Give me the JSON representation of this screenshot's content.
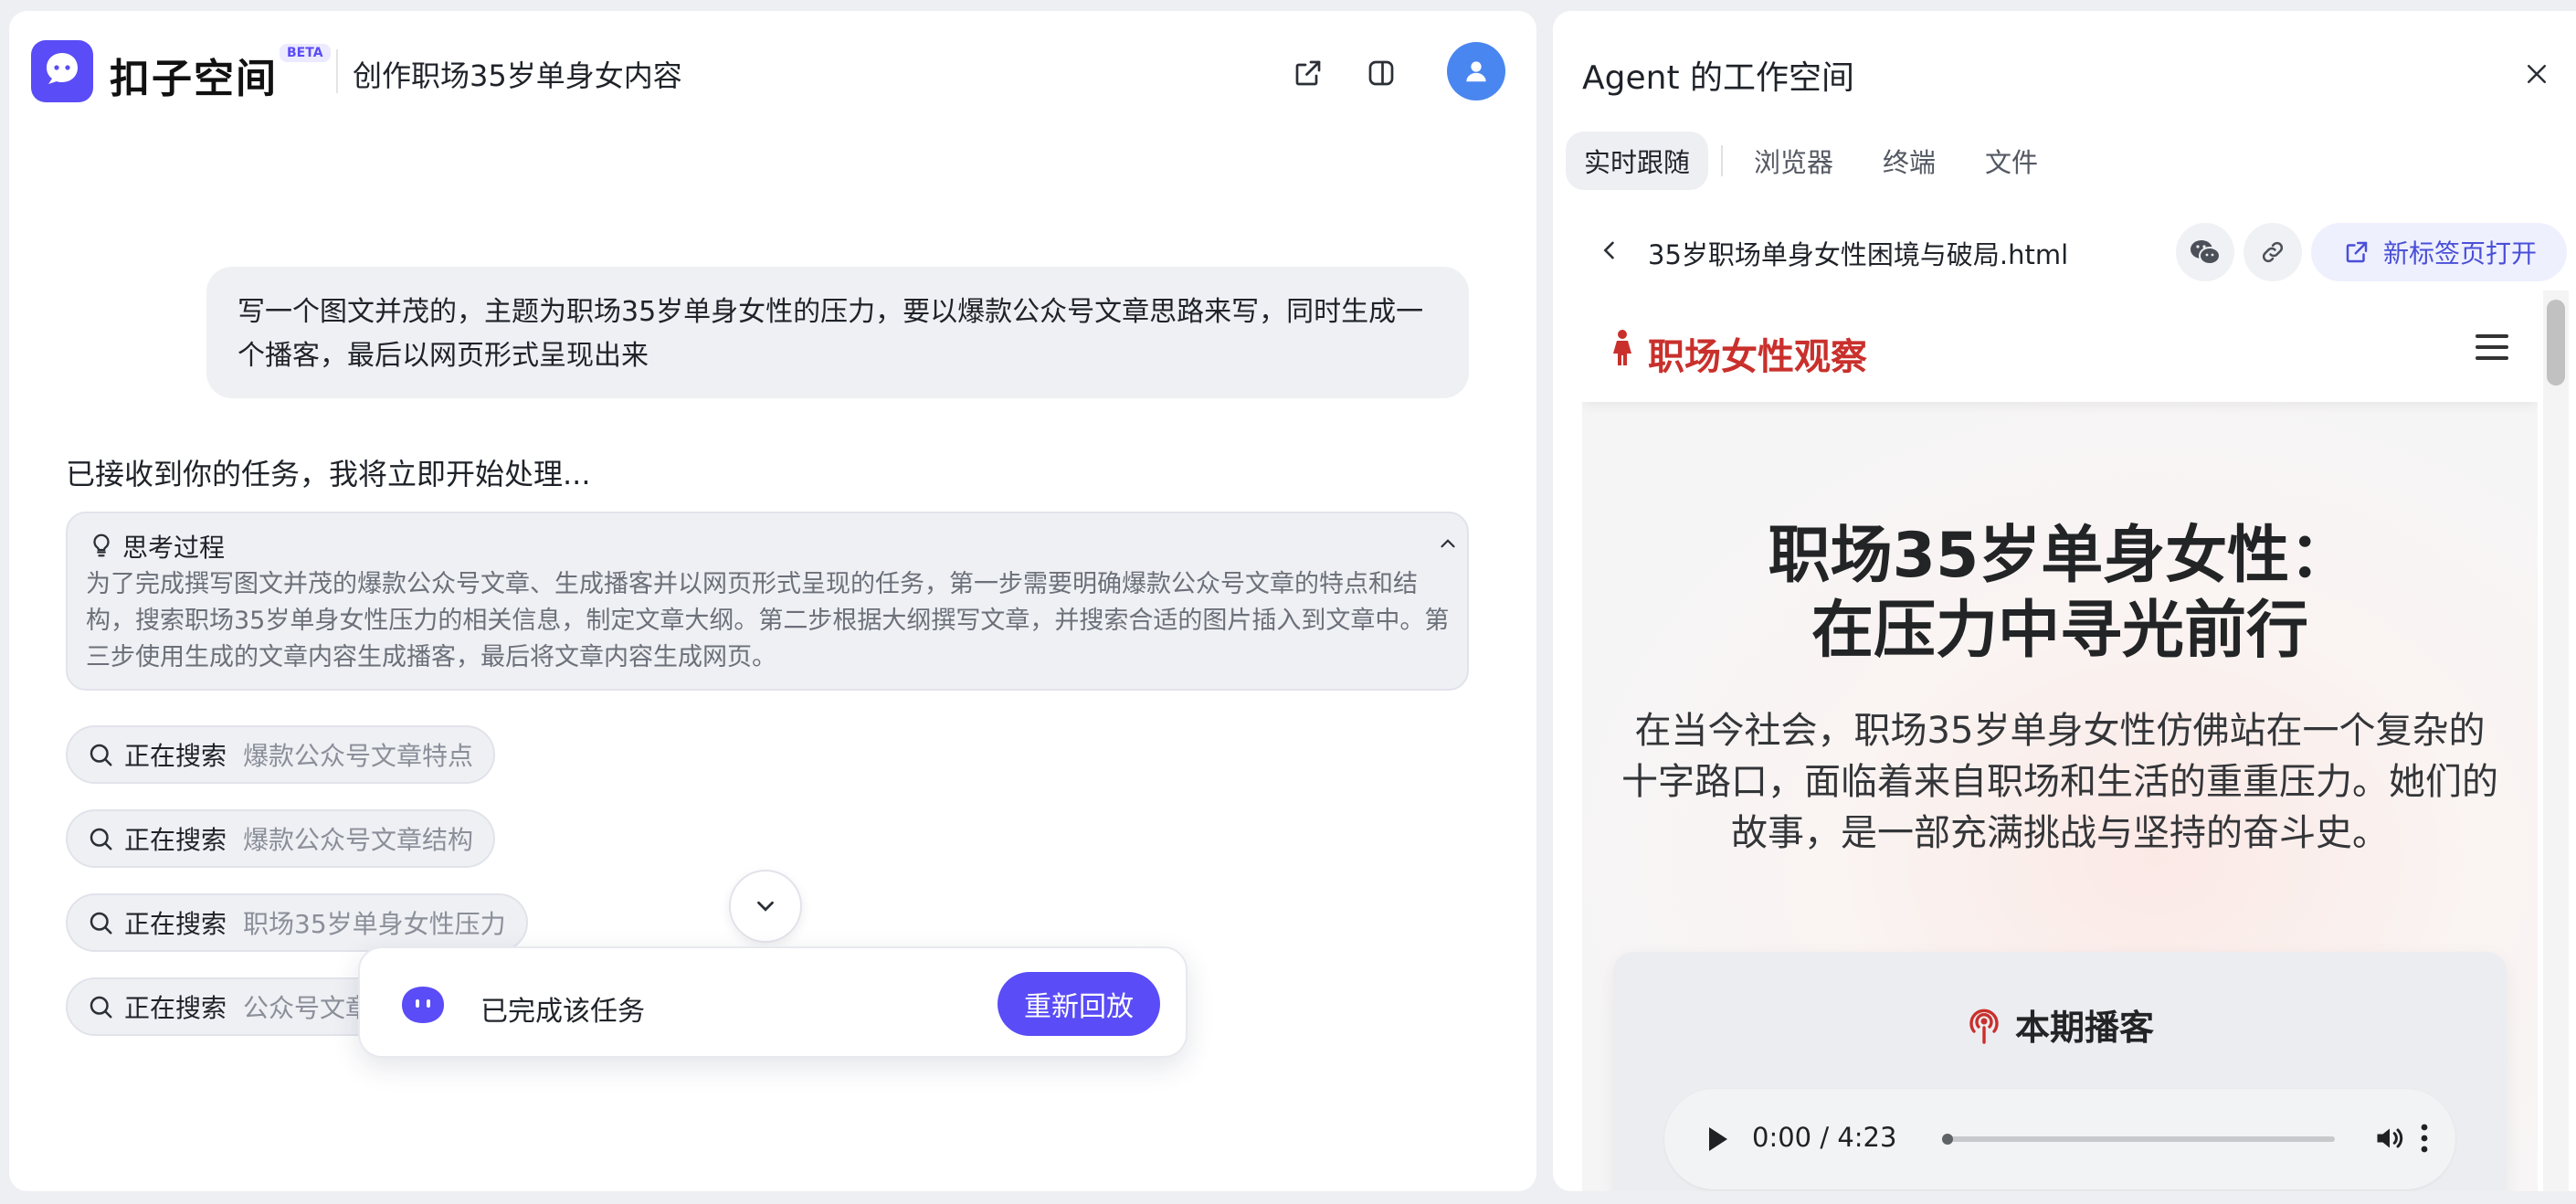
{
  "app": {
    "logo_text": "扣子空间",
    "beta": "BETA",
    "task_title": "创作职场35岁单身女内容",
    "brand_color": "#5a4cf6"
  },
  "header": {
    "share_icon": "share-icon",
    "panel_icon": "split-panel-icon",
    "avatar_icon": "user-icon"
  },
  "chat": {
    "user_message": "写一个图文并茂的，主题为职场35岁单身女性的压力，要以爆款公众号文章思路来写，同时生成一个播客，最后以网页形式呈现出来",
    "ack": "已接收到你的任务，我将立即开始处理...",
    "thinking": {
      "title": "思考过程",
      "body": "为了完成撰写图文并茂的爆款公众号文章、生成播客并以网页形式呈现的任务，第一步需要明确爆款公众号文章的特点和结构，搜索职场35岁单身女性压力的相关信息，制定文章大纲。第二步根据大纲撰写文章，并搜索合适的图片插入到文章中。第三步使用生成的文章内容生成播客，最后将文章内容生成网页。"
    },
    "searches": [
      {
        "label": "正在搜索",
        "query": "爆款公众号文章特点"
      },
      {
        "label": "正在搜索",
        "query": "爆款公众号文章结构"
      },
      {
        "label": "正在搜索",
        "query": "职场35岁单身女性压力"
      },
      {
        "label": "正在搜索",
        "query": "公众号文章写作技巧"
      }
    ]
  },
  "status_bar": {
    "text": "已完成该任务",
    "replay_button": "重新回放"
  },
  "workspace": {
    "title": "Agent 的工作空间",
    "tabs": [
      "实时跟随",
      "浏览器",
      "终端",
      "文件"
    ],
    "active_tab": "实时跟随",
    "file_name": "35岁职场单身女性困境与破局.html",
    "new_tab_button": "新标签页打开"
  },
  "preview": {
    "site_name": "职场女性观察",
    "site_color": "#c9302c",
    "hero_title_line1": "职场35岁单身女性：",
    "hero_title_line2": "在压力中寻光前行",
    "hero_desc": "在当今社会，职场35岁单身女性仿佛站在一个复杂的十字路口，面临着来自职场和生活的重重压力。她们的故事，是一部充满挑战与坚持的奋斗史。",
    "podcast_title": "本期播客",
    "audio_time": "0:00 / 4:23",
    "audio_progress": 0
  }
}
